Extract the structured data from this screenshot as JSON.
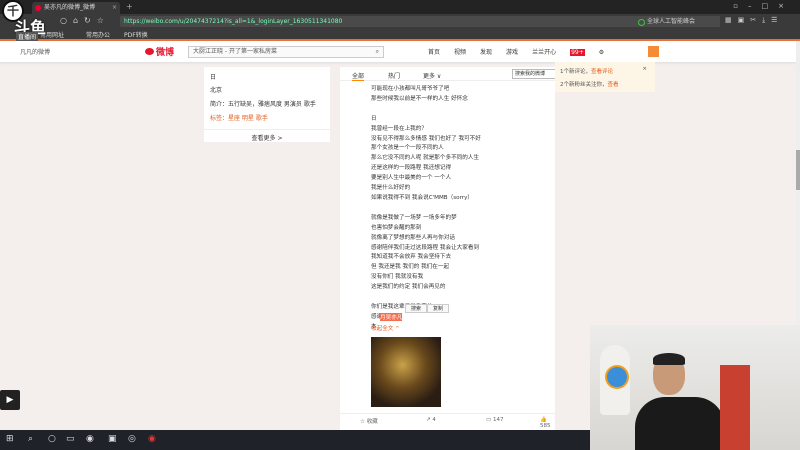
{
  "browser": {
    "tab_title": "吴亦凡的微博_微博",
    "url": "https://weibo.com/u/2047437214?is_all=1&_loginLayer_1630511341080",
    "search_placeholder": "全球人工智能峰会",
    "bookmarks": [
      "常用网址",
      "常用办公",
      "PDF转换"
    ]
  },
  "header": {
    "username": "凡凡的微博",
    "logo": "微博",
    "search_placeholder": "大厨江正晓 - 开了第一家私房菜",
    "menu": [
      "首页",
      "视频",
      "发现",
      "游戏",
      "兰兰开心"
    ],
    "badge": "99+"
  },
  "left_card": {
    "title": "日",
    "location": "北京",
    "intro": "简介：五行缺吴，雅痞风度 男演员 歌手 ",
    "tag": "标签：星座 明星 歌手",
    "more": "查看更多 >"
  },
  "feed": {
    "tabs": [
      "全部",
      "热门",
      "更多 ∨"
    ],
    "search_placeholder": "搜索我的微博",
    "lines": [
      "可能现在小孩都叫凡哥爷爷了吧",
      "那些时候我以前是不一样的人生 好怀念",
      "",
      "日",
      "我曾经一段在上我的？",
      "没有见不得那么多情感 我们也好了 我可不好",
      "那个女孩是一个一段不同的人",
      "那么它没不同的人呢 就是那个多不同的人生",
      "还是这样的一段路程 我还想记得",
      "要是别人生中最美的一个 一个人",
      "我是什么好好的",
      "如果说我得不到 我会说C'MMB（sorry）",
      "",
      "就像是我做了一场梦 一场多年的梦",
      "也害怕梦会醒的那刻",
      "就像离了梦想的那些人再与你对话",
      "感谢陪伴我们走过这段路程 我会让大家看到",
      "我知道我不会放弃 我会坚持下去",
      "但 我还是我 我们的 我们在一起",
      "没有你们 我就没有我",
      "这是我们的约定 我们会再见的",
      "",
      "你们是我这辈子最重要的",
      "感谢你——",
      "本"
    ],
    "actions": [
      "搜索",
      "复制"
    ],
    "highlight": "月吴亦凡",
    "expand": "收起全文 ^",
    "stats": [
      "收藏",
      "4",
      "147",
      "585"
    ]
  },
  "popup": {
    "line1": "1个新评论，",
    "link1": "查看评论",
    "line2": "2个新粉丝关注你，",
    "link2": "查看"
  },
  "overlay": {
    "brand": "斗鱼",
    "sub": "直播间",
    "logo": "千"
  }
}
